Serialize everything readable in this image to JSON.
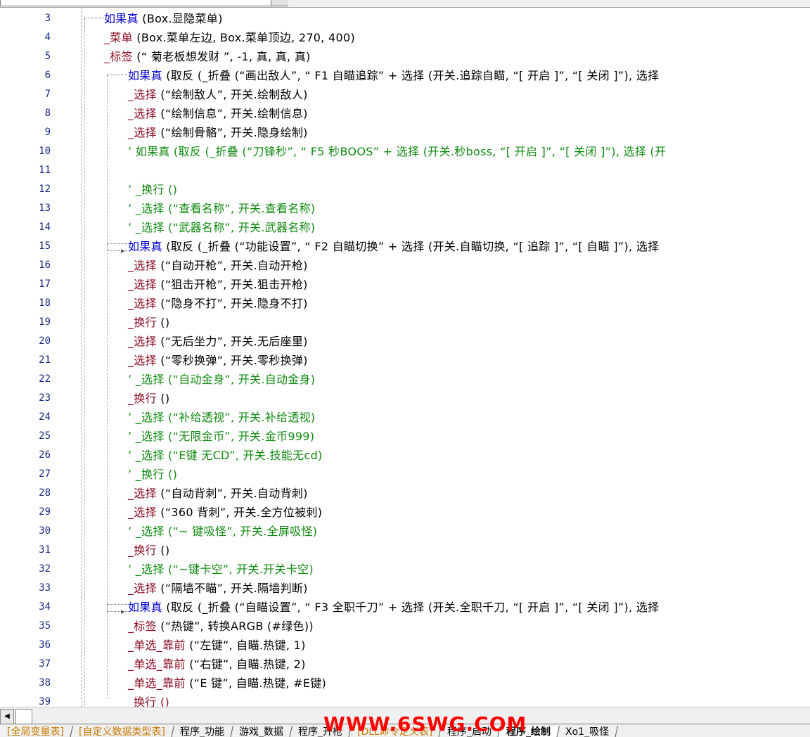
{
  "lines": [
    {
      "n": "3",
      "indent": 148,
      "parts": [
        {
          "t": "如果真",
          "c": "k-if"
        },
        {
          "t": " (Box.显隐菜单)",
          "c": "k-norm"
        }
      ],
      "fold": "open",
      "foldx": 120
    },
    {
      "n": "4",
      "indent": 148,
      "parts": [
        {
          "t": "_菜单",
          "c": "k-fn"
        },
        {
          "t": " (Box.菜单左边, Box.菜单顶边, 270, 400)",
          "c": "k-norm"
        }
      ]
    },
    {
      "n": "5",
      "indent": 148,
      "parts": [
        {
          "t": "_标签",
          "c": "k-fn"
        },
        {
          "t": " (“          菊老板想发财                    ”, -1, 真, 真, 真)",
          "c": "k-norm"
        }
      ]
    },
    {
      "n": "6",
      "indent": 182,
      "parts": [
        {
          "t": "如果真",
          "c": "k-if"
        },
        {
          "t": " (取反 (_折叠 (“画出敌人”, “ F1 自瞄追踪” + 选择 (开关.追踪自瞄, “[ 开启 ]”, “[ 关闭 ]”), 选择",
          "c": "k-norm"
        }
      ],
      "fold": "open",
      "foldx": 152
    },
    {
      "n": "7",
      "indent": 182,
      "parts": [
        {
          "t": "_选择",
          "c": "k-fn"
        },
        {
          "t": " (“绘制敌人”, 开关.绘制敌人)",
          "c": "k-norm"
        }
      ]
    },
    {
      "n": "8",
      "indent": 182,
      "parts": [
        {
          "t": "_选择",
          "c": "k-fn"
        },
        {
          "t": " (“绘制信息”, 开关.绘制信息)",
          "c": "k-norm"
        }
      ]
    },
    {
      "n": "9",
      "indent": 182,
      "parts": [
        {
          "t": "_选择",
          "c": "k-fn"
        },
        {
          "t": " (“绘制骨骼”, 开关.隐身绘制)",
          "c": "k-norm"
        }
      ]
    },
    {
      "n": "10",
      "indent": 182,
      "parts": [
        {
          "t": "’ 如果真 (取反 (_折叠 (“刀锋秒”, “ F5 秒BOOS” + 选择 (开关.秒boss, “[ 开启 ]”, “[ 关闭 ]”), 选择 (开",
          "c": "k-comment"
        }
      ]
    },
    {
      "n": "11",
      "indent": 182,
      "parts": [
        {
          "t": "",
          "c": "k-norm"
        }
      ]
    },
    {
      "n": "12",
      "indent": 182,
      "parts": [
        {
          "t": "’ _换行 ()",
          "c": "k-comment"
        }
      ]
    },
    {
      "n": "13",
      "indent": 182,
      "parts": [
        {
          "t": "’ _选择 (“查看名称”, 开关.查看名称)",
          "c": "k-comment"
        }
      ]
    },
    {
      "n": "14",
      "indent": 182,
      "parts": [
        {
          "t": "’ _选择 (“武器名称”, 开关.武器名称)",
          "c": "k-comment"
        }
      ]
    },
    {
      "n": "15",
      "indent": 182,
      "parts": [
        {
          "t": "如果真",
          "c": "k-if"
        },
        {
          "t": " (取反 (_折叠 (“功能设置”, “ F2 自瞄切换” + 选择 (开关.自瞄切换, “[ 追踪 ]”, “[ 自瞄 ]”), 选择",
          "c": "k-norm"
        }
      ],
      "fold": "closed",
      "foldx": 152
    },
    {
      "n": "16",
      "indent": 182,
      "parts": [
        {
          "t": "_选择",
          "c": "k-fn"
        },
        {
          "t": " (“自动开枪”, 开关.自动开枪)",
          "c": "k-norm"
        }
      ]
    },
    {
      "n": "17",
      "indent": 182,
      "parts": [
        {
          "t": "_选择",
          "c": "k-fn"
        },
        {
          "t": " (“狙击开枪”, 开关.狙击开枪)",
          "c": "k-norm"
        }
      ]
    },
    {
      "n": "18",
      "indent": 182,
      "parts": [
        {
          "t": "_选择",
          "c": "k-fn"
        },
        {
          "t": " (“隐身不打”, 开关.隐身不打)",
          "c": "k-norm"
        }
      ]
    },
    {
      "n": "19",
      "indent": 182,
      "parts": [
        {
          "t": "_换行",
          "c": "k-fn"
        },
        {
          "t": " ()",
          "c": "k-norm"
        }
      ]
    },
    {
      "n": "20",
      "indent": 182,
      "parts": [
        {
          "t": "_选择",
          "c": "k-fn"
        },
        {
          "t": " (“无后坐力”, 开关.无后座里)",
          "c": "k-norm"
        }
      ]
    },
    {
      "n": "21",
      "indent": 182,
      "parts": [
        {
          "t": "_选择",
          "c": "k-fn"
        },
        {
          "t": " (“零秒换弹”, 开关.零秒换弹)",
          "c": "k-norm"
        }
      ]
    },
    {
      "n": "22",
      "indent": 182,
      "parts": [
        {
          "t": "’ _选择 (“自动金身”, 开关.自动金身)",
          "c": "k-comment"
        }
      ]
    },
    {
      "n": "23",
      "indent": 182,
      "parts": [
        {
          "t": "_换行",
          "c": "k-fn"
        },
        {
          "t": " ()",
          "c": "k-norm"
        }
      ]
    },
    {
      "n": "24",
      "indent": 182,
      "parts": [
        {
          "t": "’ _选择 (“补给透视”, 开关.补给透视)",
          "c": "k-comment"
        }
      ]
    },
    {
      "n": "25",
      "indent": 182,
      "parts": [
        {
          "t": "’ _选择 (“无限金币”, 开关.金币999)",
          "c": "k-comment"
        }
      ]
    },
    {
      "n": "26",
      "indent": 182,
      "parts": [
        {
          "t": "’ _选择 (“E键 无CD”, 开关.技能无cd)",
          "c": "k-comment"
        }
      ]
    },
    {
      "n": "27",
      "indent": 182,
      "parts": [
        {
          "t": "’ _换行 ()",
          "c": "k-comment"
        }
      ]
    },
    {
      "n": "28",
      "indent": 182,
      "parts": [
        {
          "t": "_选择",
          "c": "k-fn"
        },
        {
          "t": " (“自动背刺”, 开关.自动背刺)",
          "c": "k-norm"
        }
      ]
    },
    {
      "n": "29",
      "indent": 182,
      "parts": [
        {
          "t": "_选择",
          "c": "k-fn"
        },
        {
          "t": " (“360 背刺”, 开关.全方位被刺)",
          "c": "k-norm"
        }
      ]
    },
    {
      "n": "30",
      "indent": 182,
      "parts": [
        {
          "t": "’ _选择 (“~ 键吸怪”, 开关.全屏吸怪)",
          "c": "k-comment"
        }
      ]
    },
    {
      "n": "31",
      "indent": 182,
      "parts": [
        {
          "t": "_换行",
          "c": "k-fn"
        },
        {
          "t": " ()",
          "c": "k-norm"
        }
      ]
    },
    {
      "n": "32",
      "indent": 182,
      "parts": [
        {
          "t": "’ _选择 (“~键卡空”, 开关.开关卡空)",
          "c": "k-comment"
        }
      ]
    },
    {
      "n": "33",
      "indent": 182,
      "parts": [
        {
          "t": "_选择",
          "c": "k-fn"
        },
        {
          "t": " (“隔墙不瞄”, 开关.隔墙判断)",
          "c": "k-norm"
        }
      ]
    },
    {
      "n": "34",
      "indent": 182,
      "parts": [
        {
          "t": "如果真",
          "c": "k-if"
        },
        {
          "t": " (取反 (_折叠 (“自瞄设置”, “ F3 全职千刀” + 选择 (开关.全职千刀, “[ 开启 ]”, “[ 关闭 ]”), 选择",
          "c": "k-norm"
        }
      ],
      "fold": "closed",
      "foldx": 152
    },
    {
      "n": "35",
      "indent": 182,
      "parts": [
        {
          "t": "_标签",
          "c": "k-fn"
        },
        {
          "t": " (“热键”, 转换ARGB (#绿色))",
          "c": "k-norm"
        }
      ]
    },
    {
      "n": "36",
      "indent": 182,
      "parts": [
        {
          "t": "_单选_靠前",
          "c": "k-fn"
        },
        {
          "t": " (“左键”, 自瞄.热键, 1)",
          "c": "k-norm"
        }
      ]
    },
    {
      "n": "37",
      "indent": 182,
      "parts": [
        {
          "t": "_单选_靠前",
          "c": "k-fn"
        },
        {
          "t": " (“右键”, 自瞄.热键, 2)",
          "c": "k-norm"
        }
      ]
    },
    {
      "n": "38",
      "indent": 182,
      "parts": [
        {
          "t": "_单选_靠前",
          "c": "k-fn"
        },
        {
          "t": " (“E 键”, 自瞄.热键, #E键)",
          "c": "k-norm"
        }
      ]
    },
    {
      "n": "39",
      "indent": 190,
      "parts": [
        {
          "t": "换行 ()",
          "c": "k-fn"
        }
      ]
    }
  ],
  "scroll": {
    "left_arrow": "◀"
  },
  "tabs": [
    {
      "label": "[全局变量表]",
      "style": "orange"
    },
    {
      "label": "[自定义数据类型表]",
      "style": "orange"
    },
    {
      "label": "程序_功能",
      "style": ""
    },
    {
      "label": "游戏_数据",
      "style": ""
    },
    {
      "label": "程序_开枪",
      "style": ""
    },
    {
      "label": "[DLL命令定义表]",
      "style": "orange"
    },
    {
      "label": "程序_启动",
      "style": ""
    },
    {
      "label": "程序_绘制",
      "style": "active"
    },
    {
      "label": "Xo1_吸怪",
      "style": ""
    }
  ],
  "watermark": "WWW.6SWG.COM"
}
